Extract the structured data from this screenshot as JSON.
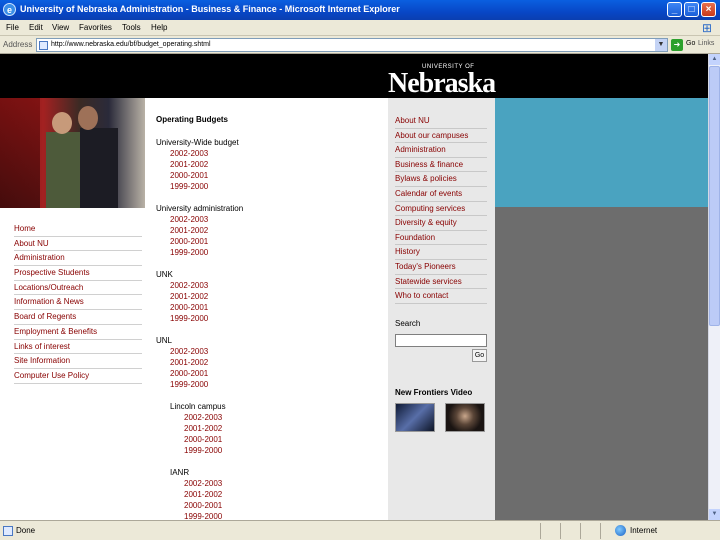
{
  "window": {
    "title": "University of Nebraska Administration - Business & Finance - Microsoft Internet Explorer",
    "icon": "ie-icon",
    "buttons": {
      "minimize": "_",
      "maximize": "□",
      "close": "×"
    }
  },
  "menu": [
    "File",
    "Edit",
    "View",
    "Favorites",
    "Tools",
    "Help"
  ],
  "address": {
    "label": "Address",
    "url": "http://www.nebraska.edu/bf/budget_operating.shtml",
    "go": "Go",
    "links": "Links"
  },
  "site": {
    "logo_small": "UNIVERSITY OF",
    "logo_main": "Nebraska"
  },
  "left_nav": [
    "Home",
    "About NU",
    "Administration",
    "Prospective Students",
    "Locations/Outreach",
    "Information & News",
    "Board of Regents",
    "Employment & Benefits",
    "Links of interest",
    "Site Information",
    "Computer Use Policy"
  ],
  "content": {
    "title": "Operating Budgets",
    "groups": [
      {
        "title": "University-Wide budget",
        "years": [
          "2002-2003",
          "2001-2002",
          "2000-2001",
          "1999-2000"
        ]
      },
      {
        "title": "University administration",
        "years": [
          "2002-2003",
          "2001-2002",
          "2000-2001",
          "1999-2000"
        ]
      },
      {
        "title": "UNK",
        "years": [
          "2002-2003",
          "2001-2002",
          "2000-2001",
          "1999-2000"
        ]
      },
      {
        "title": "UNL",
        "years": [
          "2002-2003",
          "2001-2002",
          "2000-2001",
          "1999-2000"
        ]
      },
      {
        "title": "Lincoln campus",
        "years": [
          "2002-2003",
          "2001-2002",
          "2000-2001",
          "1999-2000"
        ]
      },
      {
        "title": "IANR",
        "years": [
          "2002-2003",
          "2001-2002",
          "2000-2001",
          "1999-2000"
        ]
      }
    ]
  },
  "right_nav": [
    "About NU",
    "About our campuses",
    "Administration",
    "Business & finance",
    "Bylaws & policies",
    "Calendar of events",
    "Computing services",
    "Diversity & equity",
    "Foundation",
    "History",
    "Today's Pioneers",
    "Statewide services",
    "Who to contact"
  ],
  "search": {
    "label": "Search",
    "button": "Go"
  },
  "video": {
    "title": "New Frontiers Video"
  },
  "status": {
    "text": "Done",
    "zone": "Internet"
  }
}
